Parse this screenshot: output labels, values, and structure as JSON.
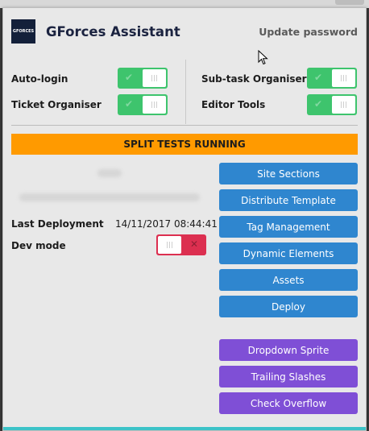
{
  "header": {
    "logo_text": "GFORCES",
    "title": "GForces Assistant",
    "update_password": "Update password"
  },
  "settings": {
    "auto_login": {
      "label": "Auto-login",
      "enabled": true
    },
    "ticket_organiser": {
      "label": "Ticket Organiser",
      "enabled": true
    },
    "subtask_organiser": {
      "label": "Sub-task Organiser",
      "enabled": true
    },
    "editor_tools": {
      "label": "Editor Tools",
      "enabled": true
    }
  },
  "banner": "SPLIT TESTS RUNNING",
  "info": {
    "last_deployment_label": "Last Deployment",
    "last_deployment_value": "14/11/2017 08:44:41",
    "dev_mode_label": "Dev mode",
    "dev_mode_enabled": false
  },
  "colors": {
    "toggle_on": "#3ec46d",
    "toggle_off": "#dc2f50",
    "banner": "#ff9a00",
    "button_blue": "#2f86cf",
    "button_purple": "#7f4fd6",
    "accent_bar": "#3cc3c8"
  },
  "buttons": {
    "site_sections": "Site Sections",
    "distribute_template": "Distribute Template",
    "tag_management": "Tag Management",
    "dynamic_elements": "Dynamic Elements",
    "assets": "Assets",
    "deploy": "Deploy",
    "dropdown_sprite": "Dropdown Sprite",
    "trailing_slashes": "Trailing Slashes",
    "check_overflow": "Check Overflow"
  }
}
